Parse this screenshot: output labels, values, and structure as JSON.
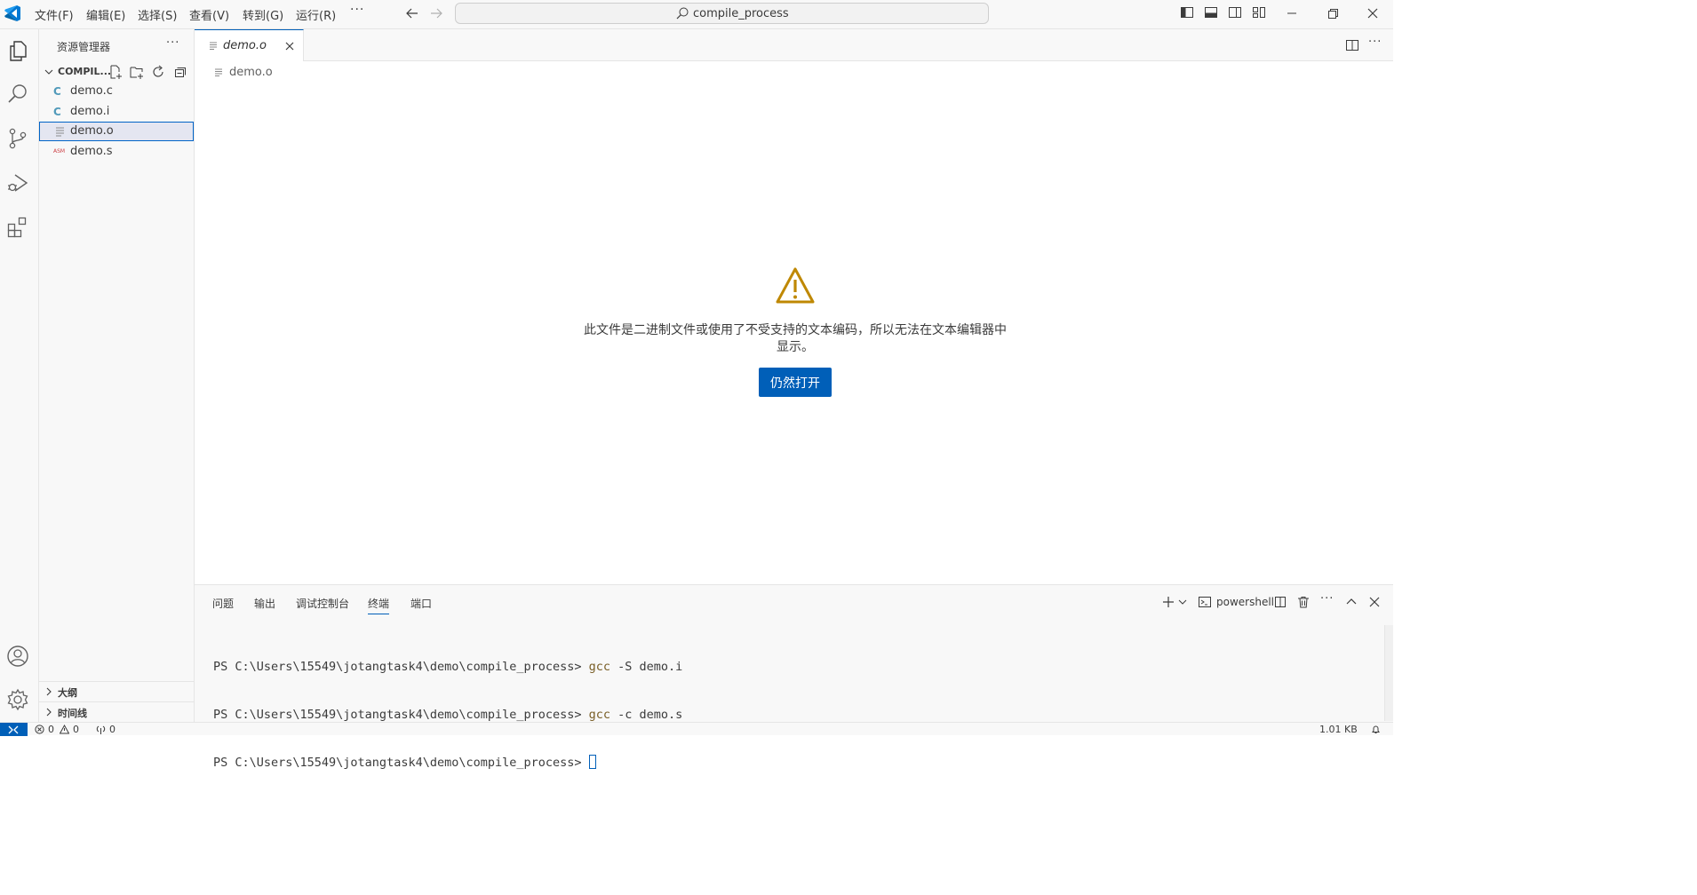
{
  "menu": {
    "file": "文件(F)",
    "edit": "编辑(E)",
    "selection": "选择(S)",
    "view": "查看(V)",
    "go": "转到(G)",
    "run": "运行(R)",
    "more": "···"
  },
  "command_center": {
    "text": "compile_process",
    "icon": "search-icon"
  },
  "sidebar": {
    "title": "资源管理器",
    "more": "···",
    "folder_name": "COMPIL...",
    "files": [
      {
        "name": "demo.c",
        "icon": "c-file-icon",
        "icon_text": "C"
      },
      {
        "name": "demo.i",
        "icon": "c-file-icon",
        "icon_text": "C"
      },
      {
        "name": "demo.o",
        "icon": "text-file-icon",
        "icon_text": ""
      },
      {
        "name": "demo.s",
        "icon": "asm-file-icon",
        "icon_text": "ASM"
      }
    ],
    "outline_label": "大纲",
    "timeline_label": "时间线"
  },
  "editor": {
    "tab_label": "demo.o",
    "breadcrumb": "demo.o",
    "binary_warning": "此文件是二进制文件或使用了不受支持的文本编码，所以无法在文本编辑器中显示。",
    "open_anyway": "仍然打开"
  },
  "panel": {
    "tabs": [
      "问题",
      "输出",
      "调试控制台",
      "终端",
      "端口"
    ],
    "active_tab": "终端",
    "shell": "powershell",
    "terminal_lines": [
      {
        "prompt": "PS C:\\Users\\15549\\jotangtask4\\demo\\compile_process> ",
        "cmd": "gcc",
        "flag": " -S ",
        "arg": "demo.i"
      },
      {
        "prompt": "PS C:\\Users\\15549\\jotangtask4\\demo\\compile_process> ",
        "cmd": "gcc",
        "flag": " -c ",
        "arg": "demo.s"
      },
      {
        "prompt": "PS C:\\Users\\15549\\jotangtask4\\demo\\compile_process> ",
        "cmd": "",
        "flag": "",
        "arg": ""
      }
    ]
  },
  "statusbar": {
    "errors": "0",
    "warnings": "0",
    "ports": "0",
    "file_size": "1.01 KB"
  },
  "colors": {
    "accent": "#005fb8",
    "warning": "#bf8803",
    "c_file": "#519aba",
    "asm_file": "#cc3e44"
  }
}
